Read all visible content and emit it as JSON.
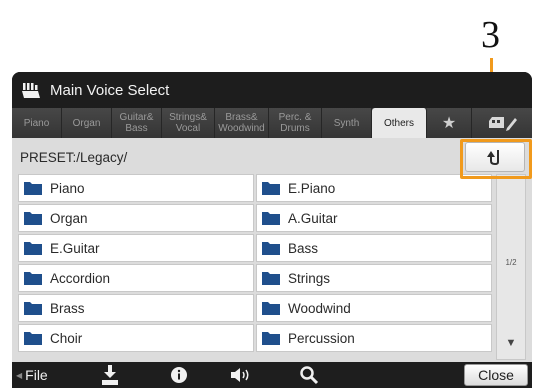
{
  "callout": {
    "number": "3"
  },
  "window": {
    "title": "Main Voice Select"
  },
  "tabs": [
    {
      "label": "Piano",
      "active": false
    },
    {
      "label": "Organ",
      "active": false
    },
    {
      "label": "Guitar&\nBass",
      "active": false
    },
    {
      "label": "Strings&\nVocal",
      "active": false
    },
    {
      "label": "Brass&\nWoodwind",
      "active": false
    },
    {
      "label": "Perc. &\nDrums",
      "active": false
    },
    {
      "label": "Synth",
      "active": false
    },
    {
      "label": "Others",
      "active": true
    },
    {
      "label": "★",
      "active": false
    },
    {
      "label": "",
      "active": false
    }
  ],
  "path": "PRESET:/Legacy/",
  "folders": [
    "Piano",
    "E.Piano",
    "Organ",
    "A.Guitar",
    "E.Guitar",
    "Bass",
    "Accordion",
    "Strings",
    "Brass",
    "Woodwind",
    "Choir",
    "Percussion"
  ],
  "scroll": {
    "page": "1/2",
    "down_arrow": "▼"
  },
  "bottom": {
    "file_arrow": "◀",
    "file_label": "File",
    "close_label": "Close"
  },
  "colors": {
    "callout": "#f19a1c",
    "folder": "#1f4f8c"
  }
}
